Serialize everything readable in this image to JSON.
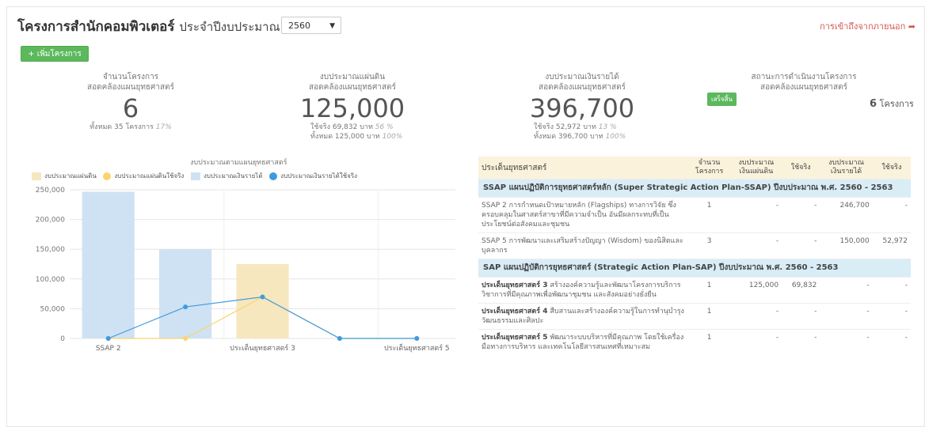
{
  "header": {
    "title": "โครงการสำนักคอมพิวเตอร์",
    "subtitle": "ประจำปีงบประมาณ",
    "year": "2560",
    "external_link": "การเข้าถึงจากภายนอก"
  },
  "add_button": "+ เพิ่มโครงการ",
  "stats": [
    {
      "label1": "จำนวนโครงการ",
      "label2": "สอดคล้องแผนยุทธศาสตร์",
      "value": "6",
      "line1": "ทั้งหมด 35 โครงการ",
      "line1_pct": "17%"
    },
    {
      "label1": "งบประมาณแผ่นดิน",
      "label2": "สอดคล้องแผนยุทธศาสตร์",
      "value": "125,000",
      "line1": "ใช้จริง 69,832 บาท",
      "line1_pct": "56 %",
      "line2": "ทั้งหมด 125,000 บาท",
      "line2_pct": "100%"
    },
    {
      "label1": "งบประมาณเงินรายได้",
      "label2": "สอดคล้องแผนยุทธศาสตร์",
      "value": "396,700",
      "line1": "ใช้จริง 52,972 บาท",
      "line1_pct": "13 %",
      "line2": "ทั้งหมด 396,700 บาท",
      "line2_pct": "100%"
    },
    {
      "label1": "สถานะการดำเนินงานโครงการ",
      "label2": "สอดคล้องแผนยุทธศาสตร์",
      "badge": "เสร็จสิ้น",
      "count": "6",
      "count_unit": "โครงการ"
    }
  ],
  "chart_data": {
    "type": "bar",
    "title": "งบประมาณตามแผนยุทธศาสตร์",
    "categories": [
      "SSAP 2",
      "SSAP 5",
      "ประเด็นยุทธศาสตร์ 3",
      "ประเด็นยุทธศาสตร์ 4",
      "ประเด็นยุทธศาสตร์ 5"
    ],
    "visible_tick_labels": [
      "SSAP 2",
      "",
      "ประเด็นยุทธศาสตร์ 3",
      "",
      "ประเด็นยุทธศาสตร์ 5"
    ],
    "ylim": [
      0,
      250000
    ],
    "yticks": [
      "0",
      "50,000",
      "100,000",
      "150,000",
      "200,000",
      "250,000"
    ],
    "legend_placement": "top",
    "series": [
      {
        "name": "งบประมาณแผ่นดิน",
        "kind": "bar",
        "color": "#f6e7bf",
        "values": [
          0,
          0,
          125000,
          0,
          0
        ]
      },
      {
        "name": "งบประมาณแผ่นดินใช้จริง",
        "kind": "line",
        "color": "#fbd46d",
        "values": [
          0,
          0,
          69832,
          0,
          0
        ]
      },
      {
        "name": "งบประมาณเงินรายได้",
        "kind": "bar",
        "color": "#cfe2f3",
        "values": [
          246700,
          150000,
          0,
          0,
          0
        ]
      },
      {
        "name": "งบประมาณเงินรายได้ใช้จริง",
        "kind": "line",
        "color": "#3f9ae0",
        "values": [
          0,
          52972,
          69832,
          0,
          0
        ]
      }
    ]
  },
  "table": {
    "headers": {
      "issue": "ประเด็นยุทธศาสตร์",
      "count": [
        "จำนวน",
        "โครงการ"
      ],
      "gov_budget": [
        "งบประมาณ",
        "เงินแผ่นดิน"
      ],
      "gov_used": "ใช้จริง",
      "rev_budget": [
        "งบประมาณ",
        "เงินรายได้"
      ],
      "rev_used": "ใช้จริง"
    },
    "groups": [
      {
        "title": "SSAP แผนปฏิบัติการยุทธศาสตร์หลัก (Super Strategic Action Plan-SSAP) ปีงบประมาณ พ.ศ. 2560 - 2563",
        "rows": [
          {
            "prefix": "",
            "title": "SSAP 2 การกำหนดเป้าหมายหลัก (Flagships) ทางการวิจัย ซึ่งครอบคลุมในศาสตร์สาขาที่มีความจำเป็น อันมีผลกระทบที่เป็นประโยชน์ต่อสังคมและชุมชน",
            "count": "1",
            "gov": "-",
            "gov_used": "-",
            "rev": "246,700",
            "rev_used": "-"
          },
          {
            "prefix": "",
            "title": "SSAP 5 การพัฒนาและเสริมสร้างปัญญา (Wisdom) ของนิสิตและบุคลากร",
            "count": "3",
            "gov": "-",
            "gov_used": "-",
            "rev": "150,000",
            "rev_used": "52,972"
          }
        ]
      },
      {
        "title": "SAP แผนปฏิบัติการยุทธศาสตร์ (Strategic Action Plan-SAP) ปีงบประมาณ พ.ศ. 2560 - 2563",
        "rows": [
          {
            "prefix": "ประเด็นยุทธศาสตร์ 3",
            "title": " สร้างองค์ความรู้และพัฒนาโครงการบริการวิชาการที่มีคุณภาพเพื่อพัฒนาชุมชน และสังคมอย่างยั่งยืน",
            "count": "1",
            "gov": "125,000",
            "gov_used": "69,832",
            "rev": "-",
            "rev_used": "-"
          },
          {
            "prefix": "ประเด็นยุทธศาสตร์ 4",
            "title": " สืบสานและสร้างองค์ความรู้ในการทำนุบำรุงวัฒนธรรมและศิลปะ",
            "count": "1",
            "gov": "-",
            "gov_used": "-",
            "rev": "-",
            "rev_used": "-"
          },
          {
            "prefix": "ประเด็นยุทธศาสตร์ 5",
            "title": " พัฒนาระบบบริหารที่มีคุณภาพ โดยใช้เครื่องมือทางการบริหาร และเทคโนโลยีสารสนเทศที่เหมาะสม",
            "count": "1",
            "gov": "-",
            "gov_used": "-",
            "rev": "-",
            "rev_used": "-"
          }
        ]
      }
    ]
  }
}
